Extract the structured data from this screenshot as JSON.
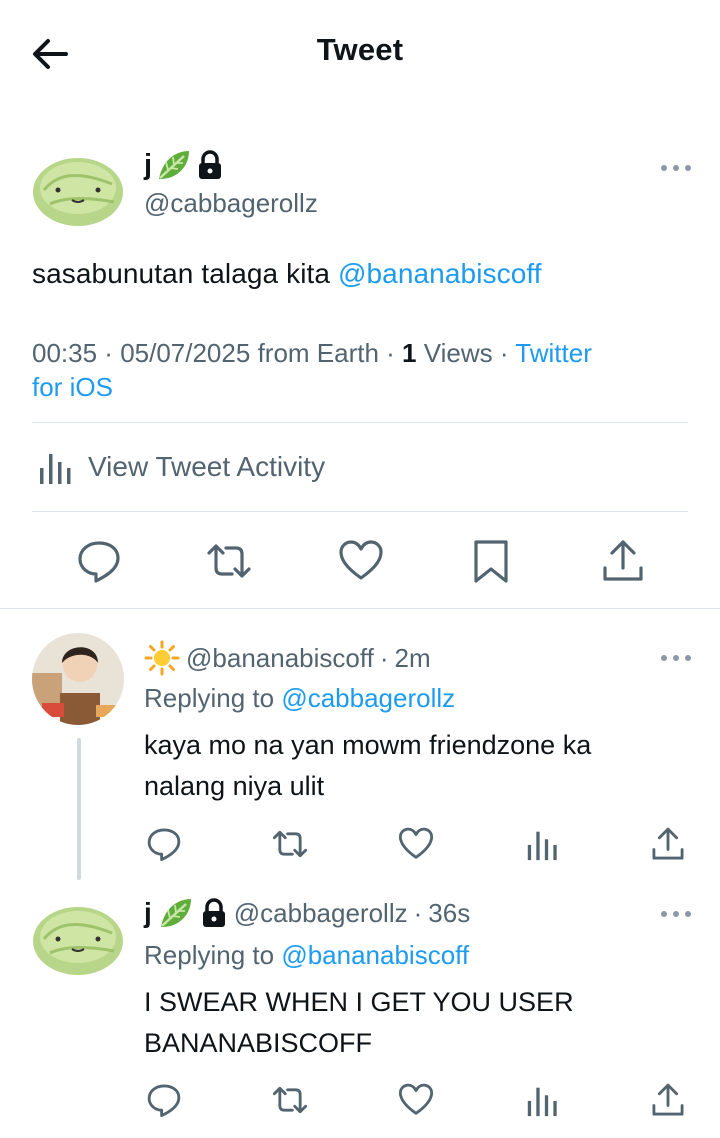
{
  "header": {
    "title": "Tweet"
  },
  "main_tweet": {
    "display_name": "j",
    "handle": "@cabbagerollz",
    "text": "sasabunutan talaga kita",
    "mention": "@bananabiscoff",
    "time": "00:35",
    "date": "05/07/2025",
    "location": "from Earth",
    "views_count": "1",
    "views_label": "Views",
    "client_line1": "Twitter",
    "client_line2": "for iOS",
    "activity_label": "View Tweet Activity"
  },
  "replies": [
    {
      "handle": "@bananabiscoff",
      "time": "2m",
      "replying_label": "Replying to",
      "replying_to": "@cabbagerollz",
      "text_line1": "kaya mo na yan mowm friendzone ka",
      "text_line2": "nalang niya ulit"
    },
    {
      "display_name": "j",
      "handle": "@cabbagerollz",
      "time": "36s",
      "replying_label": "Replying to",
      "replying_to": "@bananabiscoff",
      "text_line1": "I SWEAR WHEN I GET YOU USER",
      "text_line2": "BANANABISCOFF"
    }
  ],
  "colors": {
    "accent": "#1d9bf0",
    "muted": "#536471",
    "text": "#0f1419",
    "divider": "#dde3e8"
  },
  "icons": [
    "back-arrow-icon",
    "leaf-emoji-icon",
    "lock-icon",
    "more-icon",
    "bar-chart-icon",
    "reply-icon",
    "retweet-icon",
    "like-icon",
    "bookmark-icon",
    "share-icon",
    "sun-emoji-icon"
  ]
}
